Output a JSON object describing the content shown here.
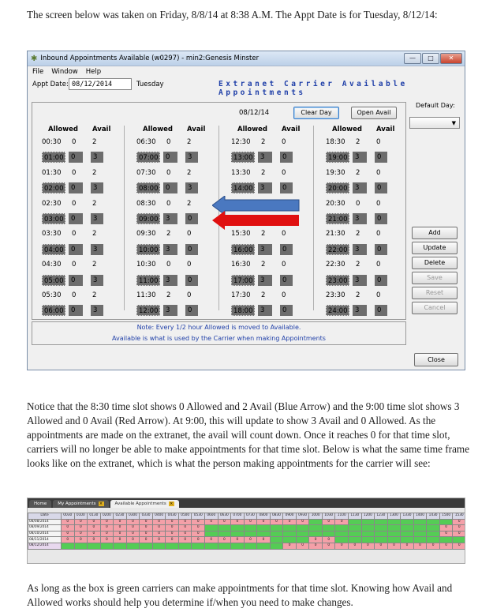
{
  "intro": "The screen below was taken on Friday, 8/8/14 at 8:38 A.M. The Appt Date is for Tuesday, 8/12/14:",
  "window": {
    "title": "Inbound Appointments Available (w0297) - min2:Genesis Minster",
    "menu": [
      "File",
      "Window",
      "Help"
    ],
    "appt_date_label": "Appt Date:",
    "appt_date_value": "08/12/2014",
    "day_of_week": "Tuesday",
    "extranet_title": "Extranet Carrier Available Appointments",
    "panel_date": "08/12/14",
    "clear_day": "Clear Day",
    "open_avail": "Open Avail",
    "default_day_label": "Default Day:",
    "col_allowed": "Allowed",
    "col_avail": "Avail",
    "columns": [
      [
        [
          "00:30",
          "0",
          "2",
          false
        ],
        [
          "01:00",
          "0",
          "3",
          true
        ],
        [
          "01:30",
          "0",
          "2",
          false
        ],
        [
          "02:00",
          "0",
          "3",
          true
        ],
        [
          "02:30",
          "0",
          "2",
          false
        ],
        [
          "03:00",
          "0",
          "3",
          true
        ],
        [
          "03:30",
          "0",
          "2",
          false
        ],
        [
          "04:00",
          "0",
          "3",
          true
        ],
        [
          "04:30",
          "0",
          "2",
          false
        ],
        [
          "05:00",
          "0",
          "3",
          true
        ],
        [
          "05:30",
          "0",
          "2",
          false
        ],
        [
          "06:00",
          "0",
          "3",
          true
        ]
      ],
      [
        [
          "06:30",
          "0",
          "2",
          false
        ],
        [
          "07:00",
          "0",
          "3",
          true
        ],
        [
          "07:30",
          "0",
          "2",
          false
        ],
        [
          "08:00",
          "0",
          "3",
          true
        ],
        [
          "08:30",
          "0",
          "2",
          false
        ],
        [
          "09:00",
          "3",
          "0",
          true
        ],
        [
          "09:30",
          "2",
          "0",
          false
        ],
        [
          "10:00",
          "3",
          "0",
          true
        ],
        [
          "10:30",
          "0",
          "0",
          false
        ],
        [
          "11:00",
          "3",
          "0",
          true
        ],
        [
          "11:30",
          "2",
          "0",
          false
        ],
        [
          "12:00",
          "3",
          "0",
          true
        ]
      ],
      [
        [
          "12:30",
          "2",
          "0",
          false
        ],
        [
          "13:00",
          "3",
          "0",
          true
        ],
        [
          "13:30",
          "2",
          "0",
          false
        ],
        [
          "14:00",
          "3",
          "0",
          true
        ],
        [
          "",
          "",
          "",
          false
        ],
        [
          "",
          "",
          "",
          true
        ],
        [
          "15:30",
          "2",
          "0",
          false
        ],
        [
          "16:00",
          "3",
          "0",
          true
        ],
        [
          "16:30",
          "2",
          "0",
          false
        ],
        [
          "17:00",
          "3",
          "0",
          true
        ],
        [
          "17:30",
          "2",
          "0",
          false
        ],
        [
          "18:00",
          "3",
          "0",
          true
        ]
      ],
      [
        [
          "18:30",
          "2",
          "0",
          false
        ],
        [
          "19:00",
          "3",
          "0",
          true
        ],
        [
          "19:30",
          "2",
          "0",
          false
        ],
        [
          "20:00",
          "3",
          "0",
          true
        ],
        [
          "20:30",
          "0",
          "0",
          false
        ],
        [
          "21:00",
          "3",
          "0",
          true
        ],
        [
          "21:30",
          "2",
          "0",
          false
        ],
        [
          "22:00",
          "3",
          "0",
          true
        ],
        [
          "22:30",
          "2",
          "0",
          false
        ],
        [
          "23:00",
          "3",
          "0",
          true
        ],
        [
          "23:30",
          "2",
          "0",
          false
        ],
        [
          "24:00",
          "3",
          "0",
          true
        ]
      ]
    ],
    "buttons": {
      "add": "Add",
      "update": "Update",
      "delete": "Delete",
      "save": "Save",
      "reset": "Reset",
      "cancel": "Cancel",
      "close": "Close"
    },
    "note_line1": "Note: Every 1/2 hour Allowed is moved to Available.",
    "note_line2": "Available is what is used by the Carrier when making Appointments",
    "arrow_colors": {
      "blue": "#4a78c0",
      "red": "#e01010"
    }
  },
  "paragraph2": "Notice that the 8:30 time slot shows 0 Allowed and 2 Avail (Blue Arrow) and the 9:00 time slot shows 3 Allowed and 0 Avail (Red Arrow). At 9:00, this will update to show 3 Avail and 0 Allowed. As the appointments are made on the extranet, the avail will count down. Once it reaches 0 for that time slot, carriers will no longer be able to make appointments for that time slot.  Below is what the same time frame looks like on the extranet, which is what the person making appointments for the carrier will see:",
  "extranet": {
    "tabs": [
      "Home",
      "My Appointments",
      "Available Appointments"
    ],
    "date_header": "Date",
    "times": [
      "0030",
      "0100",
      "0130",
      "0200",
      "0230",
      "0300",
      "0330",
      "0400",
      "0430",
      "0500",
      "0530",
      "0600",
      "0630",
      "0700",
      "0730",
      "0800",
      "0830",
      "0900",
      "0930",
      "1000",
      "1030",
      "1100",
      "1130",
      "1200",
      "1230",
      "1300",
      "1330",
      "1400",
      "1430",
      "1500",
      "1530"
    ],
    "rows": [
      {
        "date": "08/08/2014",
        "cells": "rrrrrrrrrrrrrrrrrrrgrrggggggggrrrr"
      },
      {
        "date": "08/09/2014",
        "cells": "rrrrrrrrrrrggggggggggggggggggrrrr"
      },
      {
        "date": "08/10/2014",
        "cells": "rrrrrrrrrrrggggggggggggggggggrrrr"
      },
      {
        "date": "08/11/2014",
        "cells": "rrrrrrrrrrrrrrrrgggrrgggggggggggg"
      },
      {
        "date": "08/12/2014",
        "cells": "gggggggggggggggggrrrrrrrrrrrrrrrr"
      }
    ],
    "cell_text": "0"
  },
  "paragraph3": "As long as the box is green carriers can make appointments for that time slot. Knowing how Avail and Allowed works should help you determine if/when you need to make changes."
}
